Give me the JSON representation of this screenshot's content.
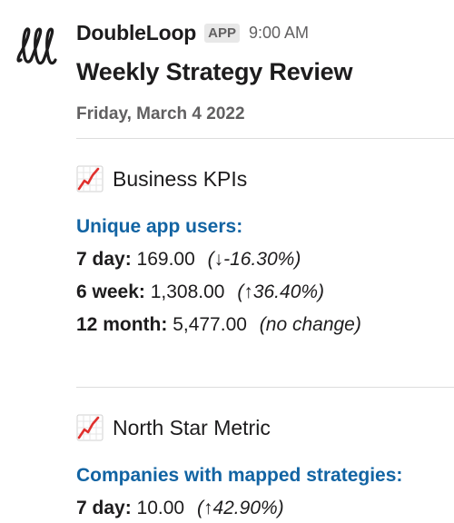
{
  "message": {
    "sender": "DoubleLoop",
    "badge": "APP",
    "time": "9:00 AM",
    "title": "Weekly Strategy Review",
    "date": "Friday, March 4 2022"
  },
  "icons": {
    "avatar": "doubleloop-logo",
    "section_icon": "chart-increasing-icon"
  },
  "colors": {
    "link_blue": "#1264a3",
    "muted_gray": "#616061",
    "badge_bg": "#e8e8e8",
    "chart_red": "#e0312e"
  },
  "sections": [
    {
      "title": "Business KPIs",
      "metric_label": "Unique app users:",
      "rows": [
        {
          "period": "7 day:",
          "value": "169.00",
          "change": "(↓-16.30%)"
        },
        {
          "period": "6 week:",
          "value": "1,308.00",
          "change": "(↑36.40%)"
        },
        {
          "period": "12 month:",
          "value": "5,477.00",
          "change": "(no change)"
        }
      ]
    },
    {
      "title": "North Star Metric",
      "metric_label": "Companies with mapped strategies:",
      "rows": [
        {
          "period": "7 day:",
          "value": "10.00",
          "change": "(↑42.90%)"
        }
      ]
    }
  ]
}
